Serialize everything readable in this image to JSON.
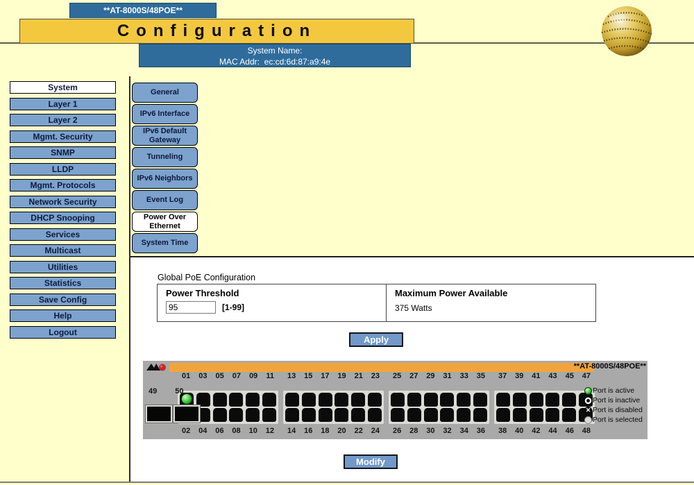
{
  "header": {
    "device_badge": "**AT-8000S/48POE**",
    "page_title": "Configuration",
    "system_name_label": "System Name:",
    "mac_label": "MAC Addr:",
    "mac_value": "ec:cd:6d:87:a9:4e"
  },
  "sidebar": {
    "items": [
      {
        "label": "System",
        "selected": true
      },
      {
        "label": "Layer 1",
        "selected": false
      },
      {
        "label": "Layer 2",
        "selected": false
      },
      {
        "label": "Mgmt. Security",
        "selected": false
      },
      {
        "label": "SNMP",
        "selected": false
      },
      {
        "label": "LLDP",
        "selected": false
      },
      {
        "label": "Mgmt. Protocols",
        "selected": false
      },
      {
        "label": "Network Security",
        "selected": false
      },
      {
        "label": "DHCP Snooping",
        "selected": false
      },
      {
        "label": "Services",
        "selected": false
      },
      {
        "label": "Multicast",
        "selected": false
      },
      {
        "label": "Utilities",
        "selected": false
      },
      {
        "label": "Statistics",
        "selected": false
      },
      {
        "label": "Save Config",
        "selected": false
      },
      {
        "label": "Help",
        "selected": false
      },
      {
        "label": "Logout",
        "selected": false
      }
    ]
  },
  "tabs": {
    "items": [
      {
        "label": "General",
        "selected": false
      },
      {
        "label": "IPv6 Interface",
        "selected": false
      },
      {
        "label": "IPv6 Default Gateway",
        "selected": false
      },
      {
        "label": "Tunneling",
        "selected": false
      },
      {
        "label": "IPv6 Neighbors",
        "selected": false
      },
      {
        "label": "Event Log",
        "selected": false
      },
      {
        "label": "Power Over Ethernet",
        "selected": true
      },
      {
        "label": "System Time",
        "selected": false
      }
    ]
  },
  "main": {
    "section_title": "Global PoE Configuration",
    "power_threshold_label": "Power Threshold",
    "power_threshold_value": "95",
    "power_threshold_range": "[1-99]",
    "max_power_label": "Maximum Power Available",
    "max_power_value": "375 Watts",
    "apply_label": "Apply",
    "modify_label": "Modify"
  },
  "switch": {
    "model_label": "**AT-8000S/48POE**",
    "uplink_labels": [
      "49",
      "50"
    ],
    "groups": [
      {
        "top": [
          "01",
          "03",
          "05",
          "07",
          "09",
          "11"
        ],
        "bottom": [
          "02",
          "04",
          "06",
          "08",
          "10",
          "12"
        ]
      },
      {
        "top": [
          "13",
          "15",
          "17",
          "19",
          "21",
          "23"
        ],
        "bottom": [
          "14",
          "16",
          "18",
          "20",
          "22",
          "24"
        ]
      },
      {
        "top": [
          "25",
          "27",
          "29",
          "31",
          "33",
          "35"
        ],
        "bottom": [
          "26",
          "28",
          "30",
          "32",
          "34",
          "36"
        ]
      },
      {
        "top": [
          "37",
          "39",
          "41",
          "43",
          "45",
          "47"
        ],
        "bottom": [
          "38",
          "40",
          "42",
          "44",
          "46",
          "48"
        ]
      }
    ],
    "active_ports": [
      "01"
    ],
    "legend": [
      {
        "state": "active",
        "label": "Port is active"
      },
      {
        "state": "inactive",
        "label": "Port is inactive"
      },
      {
        "state": "disabled",
        "label": "Port is disabled"
      },
      {
        "state": "selected",
        "label": "Port is selected"
      }
    ]
  },
  "colors": {
    "page_bg": "#FFFFCC",
    "header_blue": "#2F6C9C",
    "title_gold": "#F3C83F",
    "button_blue": "#7CA2CD",
    "action_button_blue": "#7199C9",
    "chassis_gray": "#A9A9A9",
    "strip_orange": "#F2A43B",
    "led_green": "#2FBE2F"
  }
}
